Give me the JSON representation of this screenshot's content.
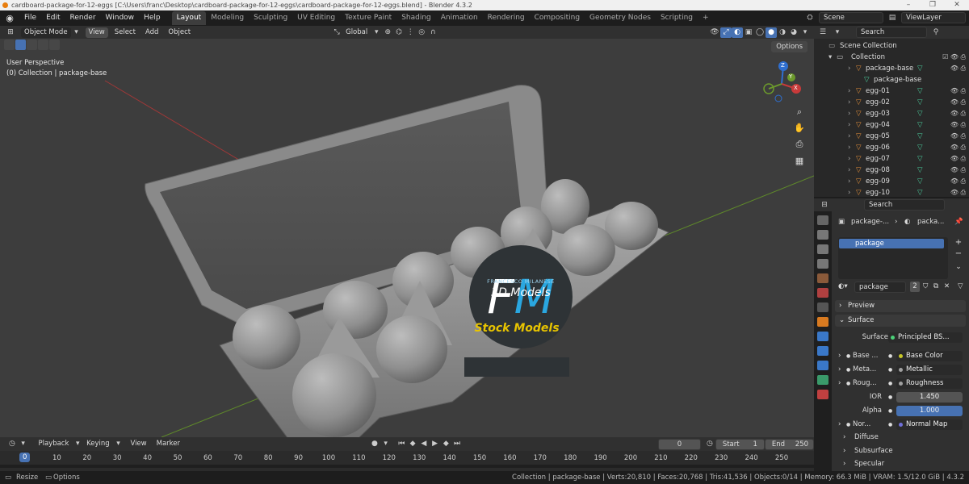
{
  "window": {
    "title": "cardboard-package-for-12-eggs [C:\\Users\\franc\\Desktop\\cardboard-package-for-12-eggs\\cardboard-package-for-12-eggs.blend] - Blender 4.3.2"
  },
  "menu": [
    "File",
    "Edit",
    "Render",
    "Window",
    "Help"
  ],
  "workspaces": [
    "Layout",
    "Modeling",
    "Sculpting",
    "UV Editing",
    "Texture Paint",
    "Shading",
    "Animation",
    "Rendering",
    "Compositing",
    "Geometry Nodes",
    "Scripting"
  ],
  "active_workspace": "Layout",
  "scene": {
    "name": "Scene",
    "view_layer": "ViewLayer"
  },
  "viewport_header": {
    "mode": "Object Mode",
    "menus": [
      "View",
      "Select",
      "Add",
      "Object"
    ],
    "transform": "Global"
  },
  "viewport": {
    "perspective": "User Perspective",
    "context": "(0) Collection | package-base",
    "options": "Options",
    "logo_line1": "FRANCESCO MILANESE",
    "logo_line2": "3D Models",
    "stock": "Stock Models",
    "axes": {
      "z": "Z",
      "y": "Y",
      "x": "X"
    },
    "colors": {
      "x_axis": "#c83a3a",
      "y_axis": "#6c9a2c",
      "z_axis": "#2f6fd0",
      "stock_text": "#e8c400"
    }
  },
  "outliner": {
    "search_placeholder": "Search",
    "scene_collection": "Scene Collection",
    "collection": "Collection",
    "items": [
      {
        "label": "package-base",
        "level": 1
      },
      {
        "label": "package-base",
        "level": 2
      },
      {
        "label": "egg-01",
        "level": 1
      },
      {
        "label": "egg-02",
        "level": 1
      },
      {
        "label": "egg-03",
        "level": 1
      },
      {
        "label": "egg-04",
        "level": 1
      },
      {
        "label": "egg-05",
        "level": 1
      },
      {
        "label": "egg-06",
        "level": 1
      },
      {
        "label": "egg-07",
        "level": 1
      },
      {
        "label": "egg-08",
        "level": 1
      },
      {
        "label": "egg-09",
        "level": 1
      },
      {
        "label": "egg-10",
        "level": 1
      }
    ]
  },
  "properties": {
    "search_placeholder": "Search",
    "breadcrumb_object": "package-...",
    "breadcrumb_material": "packa...",
    "slot": "package",
    "material_name": "package",
    "users": "2",
    "panels": {
      "preview": "Preview",
      "surface": "Surface",
      "diffuse": "Diffuse",
      "subsurface": "Subsurface",
      "specular": "Specular"
    },
    "surface_label": "Surface",
    "surface_value": "Principled BS...",
    "rows": [
      {
        "label": "Base ...",
        "value": "Base Color"
      },
      {
        "label": "Meta...",
        "value": "Metallic"
      },
      {
        "label": "Roug...",
        "value": "Roughness"
      },
      {
        "label": "IOR",
        "value": "1.450"
      },
      {
        "label": "Alpha",
        "value": "1.000"
      },
      {
        "label": "Nor...",
        "value": "Normal Map"
      }
    ]
  },
  "timeline": {
    "menus": [
      "Playback",
      "Keying",
      "View",
      "Marker"
    ],
    "current_frame": "0",
    "start_label": "Start",
    "start": "1",
    "end_label": "End",
    "end": "250",
    "ticks": [
      "0",
      "10",
      "20",
      "30",
      "40",
      "50",
      "60",
      "70",
      "80",
      "90",
      "100",
      "110",
      "120",
      "130",
      "140",
      "150",
      "160",
      "170",
      "180",
      "190",
      "200",
      "210",
      "220",
      "230",
      "240",
      "250"
    ]
  },
  "status": {
    "left1": "Resize",
    "left2": "Options",
    "right": "Collection | package-base | Verts:20,810 | Faces:20,768 | Tris:41,536 | Objects:0/14 | Memory: 66.3 MiB | VRAM: 1.5/12.0 GiB | 4.3.2"
  }
}
